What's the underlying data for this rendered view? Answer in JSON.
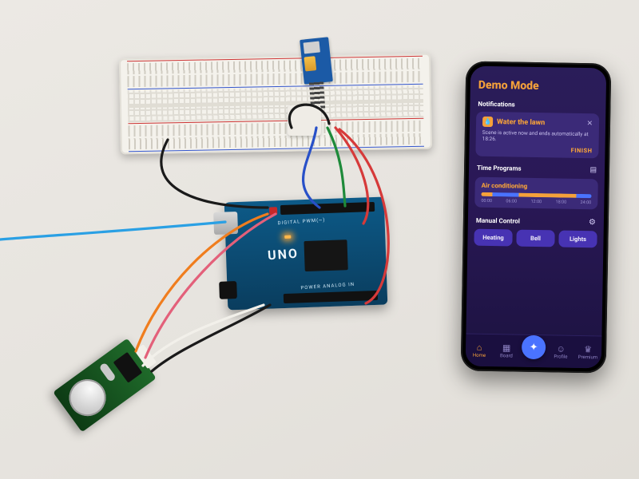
{
  "hardware": {
    "uno_label": "UNO",
    "uno_sub": "DIGITAL PWM(~)",
    "uno_sub2": "POWER    ANALOG IN"
  },
  "phone": {
    "header": "Demo Mode",
    "accent_color": "#f5a13a",
    "sections": {
      "notifications": {
        "title": "Notifications",
        "card": {
          "icon_name": "water-icon",
          "title": "Water the lawn",
          "body": "Scene is active now and ends automatically at 18:26.",
          "finish_label": "FINISH"
        }
      },
      "time_programs": {
        "title": "Time Programs",
        "card": {
          "title": "Air conditioning",
          "ticks": [
            "00:00",
            "06:00",
            "12:00",
            "18:00",
            "24:00"
          ],
          "segments": [
            {
              "color": "orange",
              "start_pct": 0,
              "end_pct": 10
            },
            {
              "color": "blue",
              "start_pct": 10,
              "end_pct": 34
            },
            {
              "color": "orange",
              "start_pct": 34,
              "end_pct": 86
            },
            {
              "color": "blue",
              "start_pct": 86,
              "end_pct": 100
            }
          ]
        }
      },
      "manual_control": {
        "title": "Manual Control",
        "pills": [
          "Heating",
          "Bell",
          "Lights"
        ]
      }
    },
    "navbar": {
      "items": [
        {
          "icon": "home-icon",
          "label": "Home",
          "active": true
        },
        {
          "icon": "board-icon",
          "label": "Board",
          "active": false
        },
        {
          "icon": "action-icon",
          "label": "",
          "center": true
        },
        {
          "icon": "profile-icon",
          "label": "Profile",
          "active": false
        },
        {
          "icon": "premium-icon",
          "label": "Premium",
          "active": false
        }
      ]
    }
  }
}
